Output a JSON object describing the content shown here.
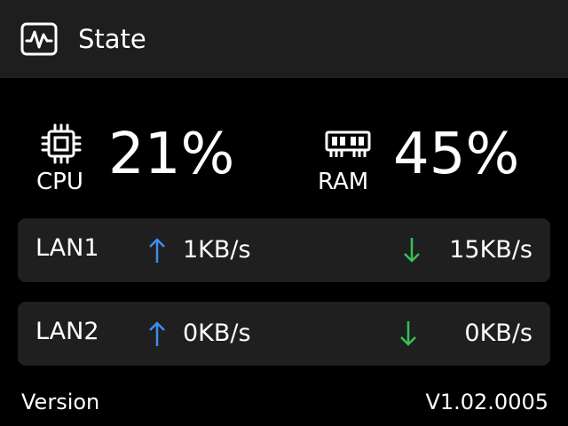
{
  "header": {
    "title": "State",
    "icon": "activity-monitor-icon"
  },
  "stats": {
    "cpu": {
      "label": "CPU",
      "value": "21%",
      "icon": "cpu-chip-icon"
    },
    "ram": {
      "label": "RAM",
      "value": "45%",
      "icon": "memory-module-icon"
    }
  },
  "network": [
    {
      "name": "LAN1",
      "upload": "1KB/s",
      "download": "15KB/s"
    },
    {
      "name": "LAN2",
      "upload": "0KB/s",
      "download": "0KB/s"
    }
  ],
  "footer": {
    "label": "Version",
    "value": "V1.02.0005"
  },
  "colors": {
    "background": "#000000",
    "header": "#1e1e1e",
    "card": "#1f1f1f",
    "upload_arrow": "#3d8ef0",
    "download_arrow": "#34c15a",
    "text": "#ffffff"
  }
}
